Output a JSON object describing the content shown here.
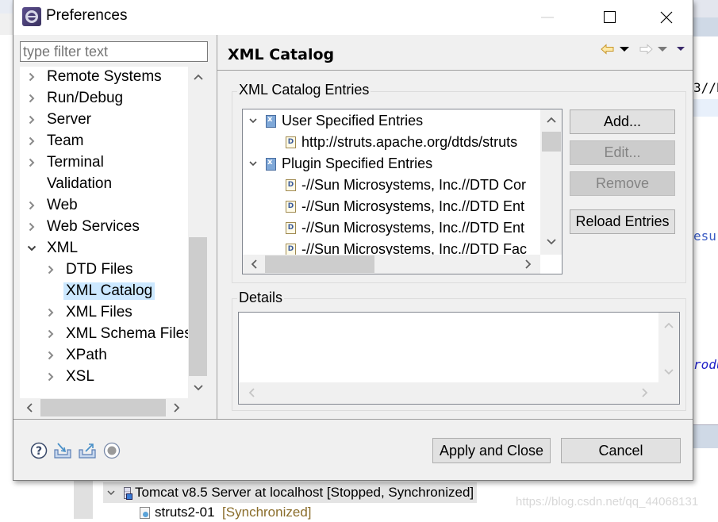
{
  "window": {
    "title": "Preferences",
    "controls": {
      "minimize": "minimize",
      "maximize": "maximize",
      "close": "close"
    }
  },
  "sidebar": {
    "filter_placeholder": "type filter text",
    "filter_value": "",
    "items": [
      {
        "label": "Remote Systems",
        "expander": "collapsed",
        "level": 0
      },
      {
        "label": "Run/Debug",
        "expander": "collapsed",
        "level": 0
      },
      {
        "label": "Server",
        "expander": "collapsed",
        "level": 0
      },
      {
        "label": "Team",
        "expander": "collapsed",
        "level": 0
      },
      {
        "label": "Terminal",
        "expander": "collapsed",
        "level": 0
      },
      {
        "label": "Validation",
        "expander": "none",
        "level": 0
      },
      {
        "label": "Web",
        "expander": "collapsed",
        "level": 0
      },
      {
        "label": "Web Services",
        "expander": "collapsed",
        "level": 0
      },
      {
        "label": "XML",
        "expander": "expanded",
        "level": 0
      },
      {
        "label": "DTD Files",
        "expander": "collapsed",
        "level": 1
      },
      {
        "label": "XML Catalog",
        "expander": "none",
        "level": 1,
        "selected": true
      },
      {
        "label": "XML Files",
        "expander": "collapsed",
        "level": 1
      },
      {
        "label": "XML Schema Files",
        "expander": "collapsed",
        "level": 1
      },
      {
        "label": "XPath",
        "expander": "collapsed",
        "level": 1
      },
      {
        "label": "XSL",
        "expander": "collapsed",
        "level": 1
      }
    ]
  },
  "page": {
    "title": "XML Catalog",
    "nav": {
      "back": "back-arrow",
      "forward": "forward-arrow",
      "menu": "view-menu"
    },
    "entries_group_label": "XML Catalog Entries",
    "entries": [
      {
        "label": "User Specified Entries",
        "type": "category",
        "expanded": true,
        "level": 0
      },
      {
        "label": "http://struts.apache.org/dtds/struts",
        "type": "dtd",
        "level": 1
      },
      {
        "label": "Plugin Specified Entries",
        "type": "category",
        "expanded": true,
        "level": 0
      },
      {
        "label": "-//Sun Microsystems, Inc.//DTD Cor",
        "type": "dtd",
        "level": 1
      },
      {
        "label": "-//Sun Microsystems, Inc.//DTD Ent",
        "type": "dtd",
        "level": 1
      },
      {
        "label": "-//Sun Microsystems, Inc.//DTD Ent",
        "type": "dtd",
        "level": 1
      },
      {
        "label": "-//Sun Microsystems, Inc.//DTD Fac",
        "type": "dtd",
        "level": 1
      }
    ],
    "dtd_icon_letter": "D",
    "buttons": {
      "add": "Add...",
      "edit": "Edit...",
      "remove": "Remove",
      "reload": "Reload Entries"
    },
    "details_label": "Details",
    "details_text": ""
  },
  "footer": {
    "icons": [
      "help-icon",
      "import-icon",
      "export-icon",
      "record-icon"
    ],
    "apply_close": "Apply and Close",
    "cancel": "Cancel"
  },
  "background": {
    "server_row": "Tomcat v8.5 Server at localhost  [Stopped, Synchronized]",
    "project_name": "struts2-01",
    "project_status": "[Synchronized]",
    "code_fragments": [
      "3//E",
      "esu",
      "rodu"
    ],
    "watermark": "https://blog.csdn.net/qq_44068131"
  },
  "colors": {
    "selection": "#cce8ff",
    "dialog_bg": "#f0f0f0",
    "button_bg": "#e1e1e1",
    "disabled_text": "#838383",
    "code_blue": "#3040c0"
  }
}
